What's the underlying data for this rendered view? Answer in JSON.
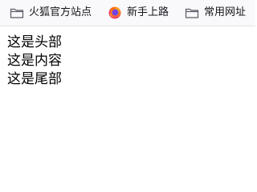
{
  "bookmarks_bar": {
    "items": [
      {
        "label": "火狐官方站点",
        "icon": "folder-icon"
      },
      {
        "label": "新手上路",
        "icon": "firefox-icon"
      },
      {
        "label": "常用网址",
        "icon": "folder-icon"
      }
    ]
  },
  "page": {
    "lines": [
      "这是头部",
      "这是内容",
      "这是尾部"
    ]
  },
  "colors": {
    "bar_background": "#f9f9fb",
    "text": "#000000"
  }
}
